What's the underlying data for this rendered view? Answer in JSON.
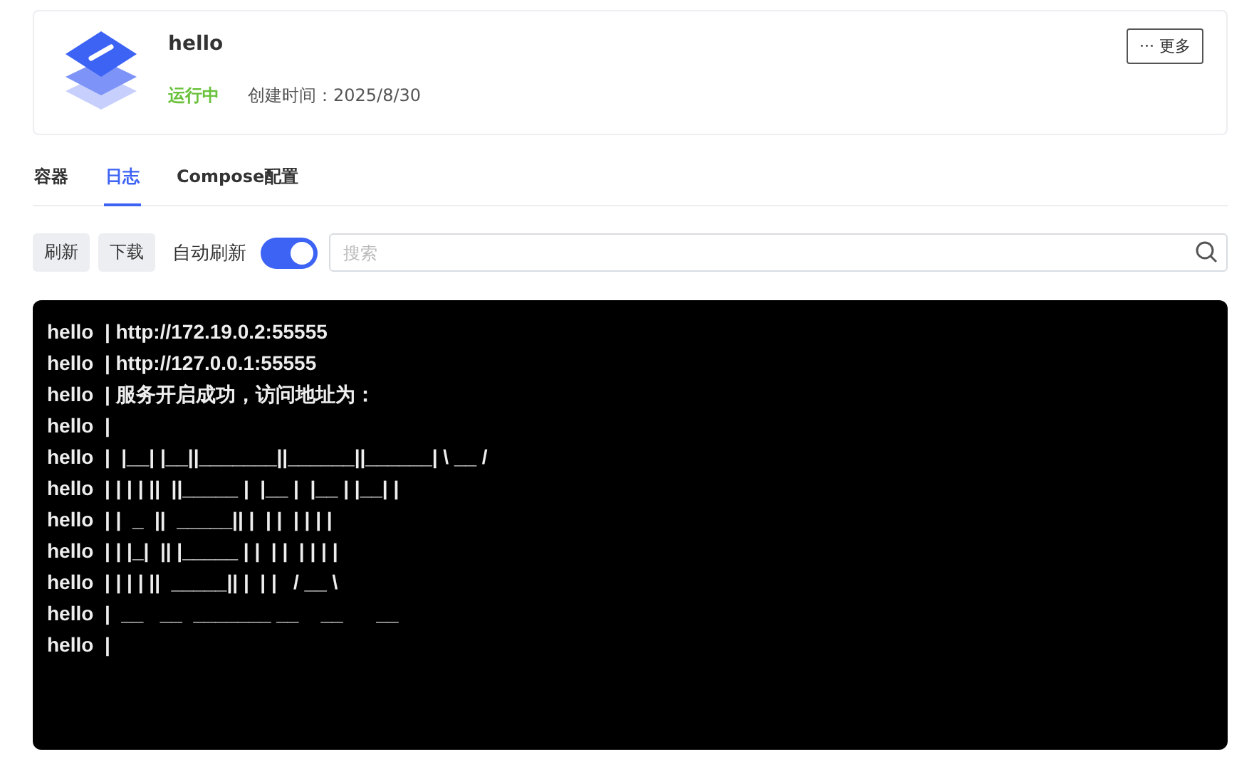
{
  "app": {
    "name": "hello",
    "status": "运行中",
    "created": "创建时间：2025/8/30",
    "more_button": {
      "icon": "···",
      "label": "更多"
    }
  },
  "tabs": [
    {
      "label": "容器",
      "selected": false
    },
    {
      "label": "日志",
      "selected": true
    },
    {
      "label": "Compose配置",
      "selected": false
    }
  ],
  "toolbar": {
    "refresh_button": "刷新",
    "download_button": "下载",
    "auto_refresh": {
      "label": "自动刷新",
      "on": true
    },
    "search": {
      "placeholder": "搜索"
    }
  },
  "log_lines": [
    "hello  | http://172.19.0.2:55555",
    "hello  | http://127.0.0.1:55555",
    "hello  | 服务开启成功，访问地址为：",
    "hello  |",
    "hello  |  |__| |__||_______||______||______| \\ __ /",
    "hello  | | | | ||  ||_____ |  |__ |  |__ | |__| |",
    "hello  | |  _  ||  _____|| |  | |  | | | |",
    "hello  | | |_|  || |_____ | |  | |  | | | |",
    "hello  | | | | ||  _____|| |  | |   / __ \\",
    "hello  |  __   __  _______ __    __      __",
    "hello  |"
  ]
}
